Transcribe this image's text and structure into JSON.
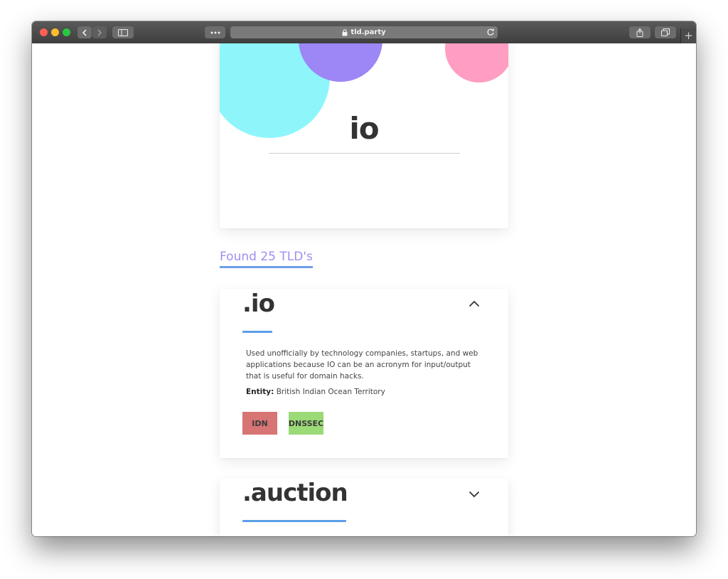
{
  "browser": {
    "url": "tld.party",
    "new_tab": "+"
  },
  "hero": {
    "title": "io"
  },
  "results": {
    "found_text": "Found 25 TLD's"
  },
  "tlds": [
    {
      "name": ".io",
      "expanded": true,
      "description": "Used unofficially by technology companies, startups, and web applications because IO can be an acronym for input/output that is useful for domain hacks.",
      "entity_label": "Entity:",
      "entity_value": "British Indian Ocean Territory",
      "badges": [
        "IDN",
        "DNSSEC"
      ]
    },
    {
      "name": ".auction",
      "expanded": false
    }
  ],
  "colors": {
    "accent_underline": "#5a9ee8",
    "found_text": "#9d8ef1",
    "badge_idn": "#d77474",
    "badge_dnssec": "#9cd977",
    "circle_cyan": "#8ef6fb",
    "circle_purple": "#9d86f5",
    "circle_pink": "#ff9dc2"
  },
  "icons": {
    "back": "chevron-left-icon",
    "forward": "chevron-right-icon",
    "sidebar": "sidebar-icon",
    "extensions": "more-dots-icon",
    "lock": "lock-icon",
    "reload": "reload-icon",
    "share": "share-icon",
    "tabs": "tabs-icon",
    "collapse": "chevron-up-icon",
    "expand": "chevron-down-icon"
  }
}
